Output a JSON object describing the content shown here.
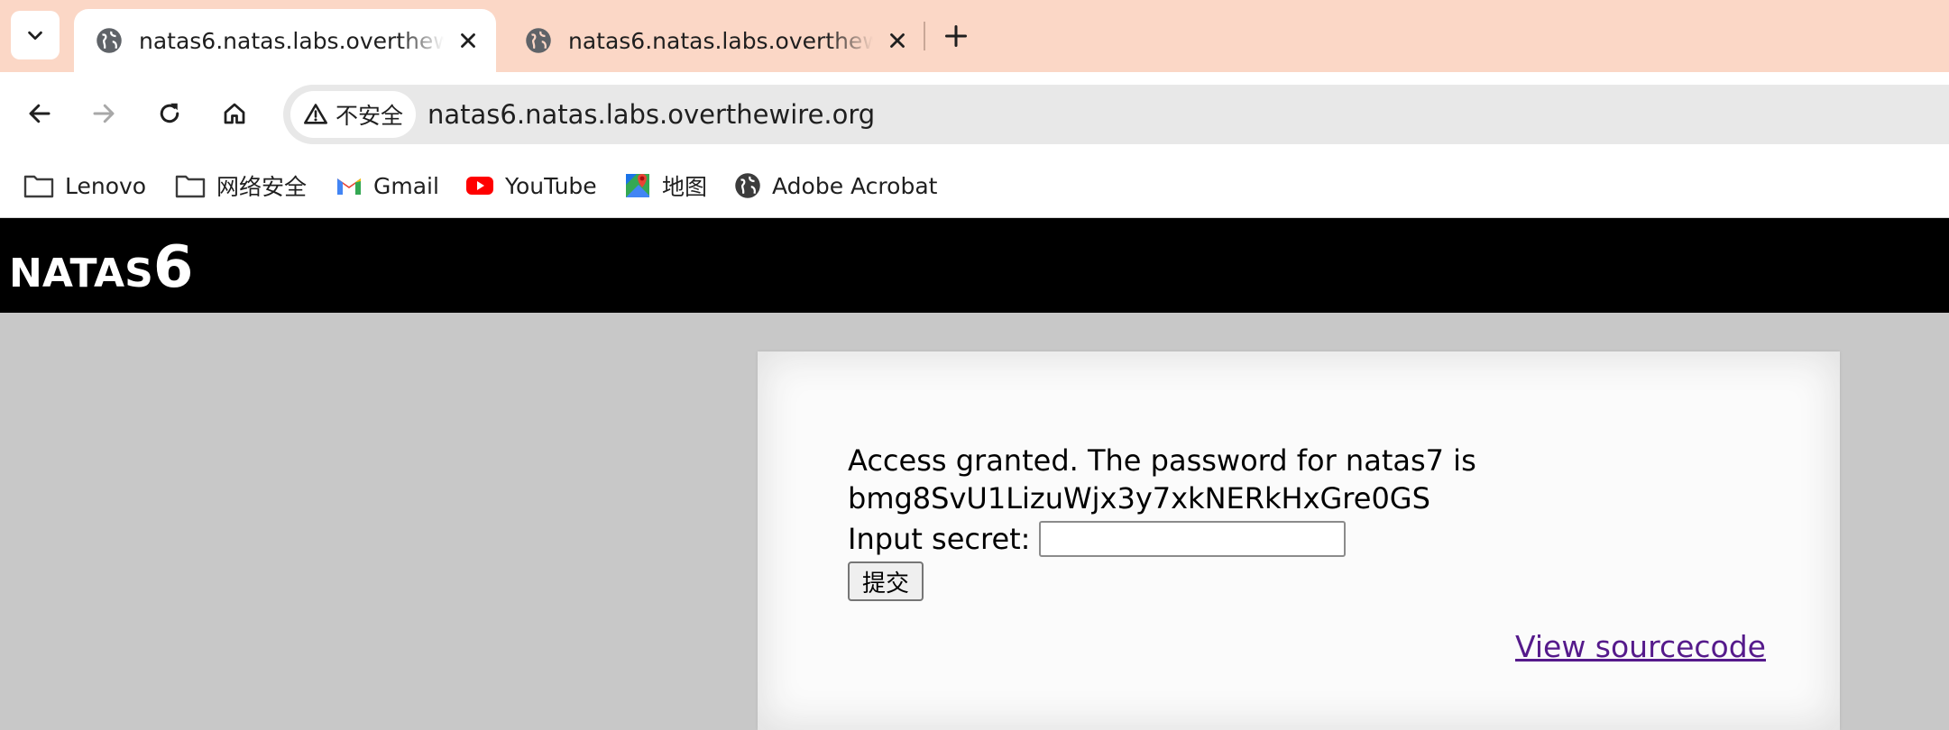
{
  "browser": {
    "tabs": [
      {
        "title": "natas6.natas.labs.overthewire.org",
        "active": true
      },
      {
        "title": "natas6.natas.labs.overthewire.org",
        "active": false
      }
    ],
    "security_label": "不安全",
    "url": "natas6.natas.labs.overthewire.org",
    "bookmarks": [
      {
        "label": "Lenovo",
        "icon": "folder-icon"
      },
      {
        "label": "网络安全",
        "icon": "folder-icon"
      },
      {
        "label": "Gmail",
        "icon": "gmail-icon"
      },
      {
        "label": "YouTube",
        "icon": "youtube-icon"
      },
      {
        "label": "地图",
        "icon": "maps-icon"
      },
      {
        "label": "Adobe Acrobat",
        "icon": "globe-icon"
      }
    ],
    "colors": {
      "tabstrip": "#fbd7c6",
      "omnibox": "#e8e8e8"
    }
  },
  "page": {
    "header_prefix": "NATAS",
    "header_number": "6",
    "message_line1": "Access granted. The password for natas7 is",
    "message_line2": "bmg8SvU1LizuWjx3y7xkNERkHxGre0GS",
    "secret_label": "Input secret:",
    "secret_value": "",
    "submit_label": "提交",
    "source_link": "View sourcecode",
    "colors": {
      "header_bg": "#000000",
      "page_bg": "#c8c8c8",
      "link": "#551a8b"
    }
  }
}
